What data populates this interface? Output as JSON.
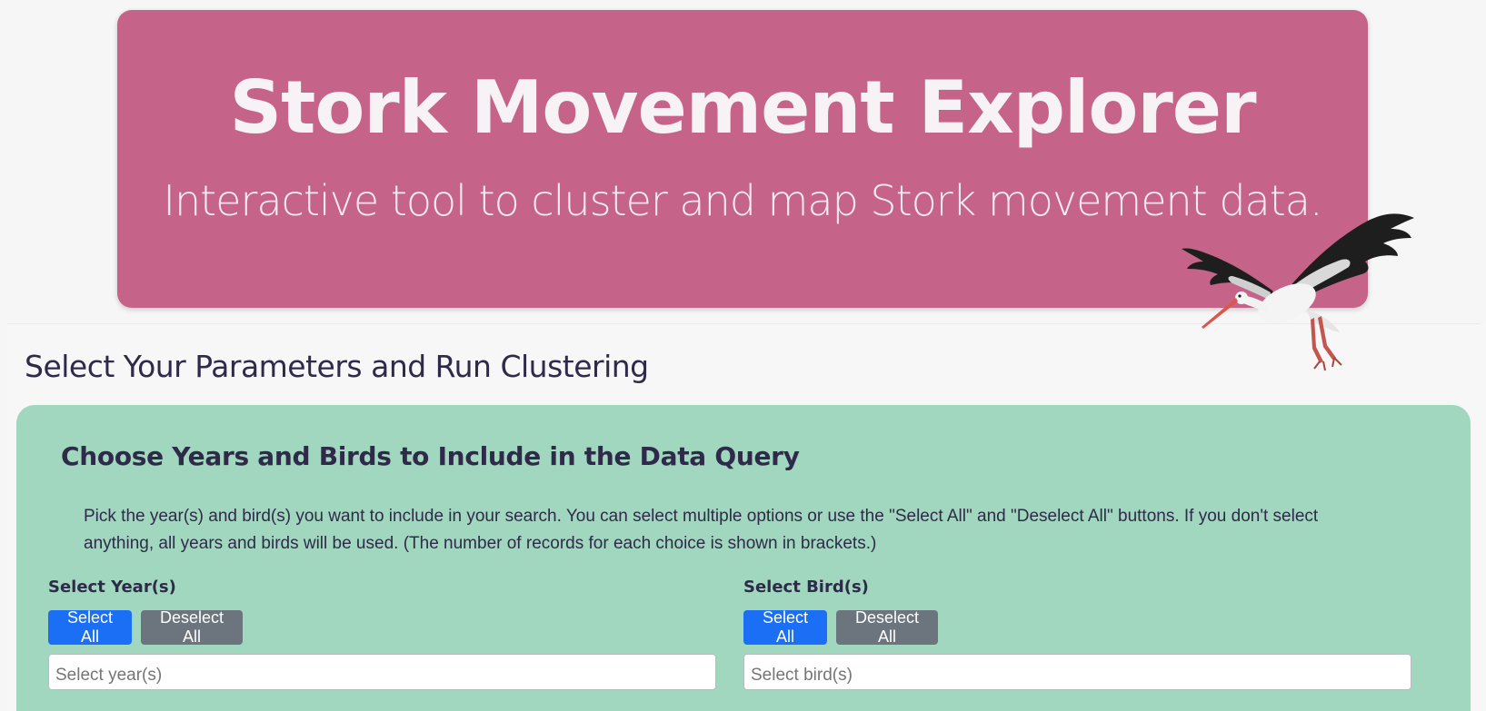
{
  "hero": {
    "title": "Stork Movement Explorer",
    "subtitle": "Interactive tool to cluster and map Stork movement data."
  },
  "params": {
    "heading": "Select Your Parameters and Run Clustering"
  },
  "query": {
    "title": "Choose Years and Birds to Include in the Data Query",
    "description": "Pick the year(s) and bird(s) you want to include in your search. You can select multiple options or use the \"Select All\" and \"Deselect All\" buttons. If you don't select anything, all years and birds will be used. (The number of records for each choice is shown in brackets.)",
    "years": {
      "label": "Select Year(s)",
      "select_all": "Select All",
      "deselect_all": "Deselect All",
      "placeholder": "Select year(s)"
    },
    "birds": {
      "label": "Select Bird(s)",
      "select_all": "Select All",
      "deselect_all": "Deselect All",
      "placeholder": "Select bird(s)"
    }
  },
  "colors": {
    "hero_bg": "#c56488",
    "card_bg": "#a1d7be",
    "primary_button": "#1a6ff5",
    "secondary_button": "#6c757d",
    "heading_text": "#2f2a4a"
  },
  "icons": {
    "stork": "stork-illustration"
  }
}
